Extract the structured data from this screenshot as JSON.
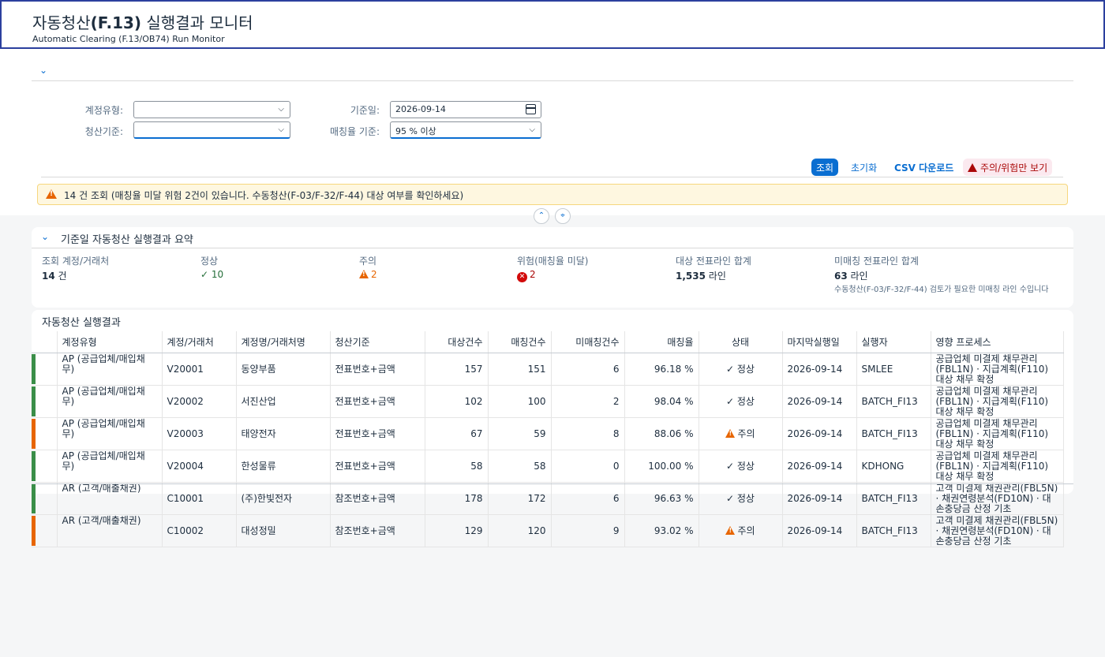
{
  "header": {
    "title_prefix": "자동청산",
    "title_code": "(F.13)",
    "title_suffix": " 실행결과 모니터",
    "subtitle": "Automatic Clearing (F.13/OB74) Run Monitor"
  },
  "filters": {
    "account_type_label": "계정유형:",
    "account_type_value": "",
    "clearing_basis_label": "청산기준:",
    "clearing_basis_value": "",
    "base_date_label": "기준일:",
    "base_date_value": "2026-09-14",
    "match_rate_label": "매칭율 기준:",
    "match_rate_value": "95 % 이상"
  },
  "toolbar": {
    "search_label": "조회",
    "reset_label": "초기화",
    "csv_label": "CSV 다운로드",
    "risk_only_label": "주의/위험만 보기"
  },
  "message": "14 건 조회 (매칭율 미달 위험 2건이 있습니다. 수동청산(F-03/F-32/F-44) 대상 여부를 확인하세요)",
  "summary": {
    "title": "기준일 자동청산 실행결과 요약",
    "kpis": [
      {
        "label": "조회 계정/거래처",
        "value": "14",
        "unit": " 건"
      },
      {
        "label": "정상",
        "value": "10"
      },
      {
        "label": "주의",
        "value": "2"
      },
      {
        "label": "위험(매칭율 미달)",
        "value": "2"
      },
      {
        "label": "대상 전표라인 합계",
        "value": "1,535",
        "unit": " 라인"
      },
      {
        "label": "미매칭 전표라인 합계",
        "value": "63",
        "unit": " 라인",
        "note": "수동청산(F-03/F-32/F-44) 검토가 필요한 미매칭 라인 수입니다"
      }
    ]
  },
  "results": {
    "title": "자동청산 실행결과",
    "columns": [
      "계정유형",
      "계정/거래처",
      "계정명/거래처명",
      "청산기준",
      "대상건수",
      "매칭건수",
      "미매칭건수",
      "매칭율",
      "상태",
      "마지막실행일",
      "실행자",
      "영향 프로세스"
    ],
    "rows": [
      {
        "type": "AP (공급업체/매입채무)",
        "account": "V20001",
        "name": "동양부품",
        "basis": "전표번호+금액",
        "target": "157",
        "matched": "151",
        "unmatched": "6",
        "rate": "96.18 %",
        "status": "정상",
        "status_kind": "ok",
        "last_run": "2026-09-14",
        "runner": "SMLEE",
        "impact": "공급업체 미결제 채무관리(FBL1N) · 지급계획(F110) 대상 채무 확정",
        "indicator_color": "#3a8e48"
      },
      {
        "type": "AP (공급업체/매입채무)",
        "account": "V20002",
        "name": "서진산업",
        "basis": "전표번호+금액",
        "target": "102",
        "matched": "100",
        "unmatched": "2",
        "rate": "98.04 %",
        "status": "정상",
        "status_kind": "ok",
        "last_run": "2026-09-14",
        "runner": "BATCH_FI13",
        "impact": "공급업체 미결제 채무관리(FBL1N) · 지급계획(F110) 대상 채무 확정",
        "indicator_color": "#3a8e48"
      },
      {
        "type": "AP (공급업체/매입채무)",
        "account": "V20003",
        "name": "태양전자",
        "basis": "전표번호+금액",
        "target": "67",
        "matched": "59",
        "unmatched": "8",
        "rate": "88.06 %",
        "status": "주의",
        "status_kind": "warn",
        "last_run": "2026-09-14",
        "runner": "BATCH_FI13",
        "impact": "공급업체 미결제 채무관리(FBL1N) · 지급계획(F110) 대상 채무 확정",
        "indicator_color": "#e76500"
      },
      {
        "type": "AP (공급업체/매입채무)",
        "account": "V20004",
        "name": "한성물류",
        "basis": "전표번호+금액",
        "target": "58",
        "matched": "58",
        "unmatched": "0",
        "rate": "100.00 %",
        "status": "정상",
        "status_kind": "ok",
        "last_run": "2026-09-14",
        "runner": "KDHONG",
        "impact": "공급업체 미결제 채무관리(FBL1N) · 지급계획(F110) 대상 채무 확정",
        "indicator_color": "#3a8e48"
      },
      {
        "type": "AR (고객/매출채권)",
        "account": "C10001",
        "name": "(주)한빛전자",
        "basis": "참조번호+금액",
        "target": "178",
        "matched": "172",
        "unmatched": "6",
        "rate": "96.63 %",
        "status": "정상",
        "status_kind": "ok",
        "last_run": "2026-09-14",
        "runner": "BATCH_FI13",
        "impact": "고객 미결제 채권관리(FBL5N) · 채권연령분석(FD10N) · 대손충당금 산정 기초",
        "indicator_color": "#3a8e48"
      },
      {
        "type": "AR (고객/매출채권)",
        "account": "C10002",
        "name": "대성정밀",
        "basis": "참조번호+금액",
        "target": "129",
        "matched": "120",
        "unmatched": "9",
        "rate": "93.02 %",
        "status": "주의",
        "status_kind": "warn",
        "last_run": "2026-09-14",
        "runner": "BATCH_FI13",
        "impact": "고객 미결제 채권관리(FBL5N) · 채권연령분석(FD10N) · 대손충당금 산정 기초",
        "indicator_color": "#e76500"
      }
    ]
  }
}
